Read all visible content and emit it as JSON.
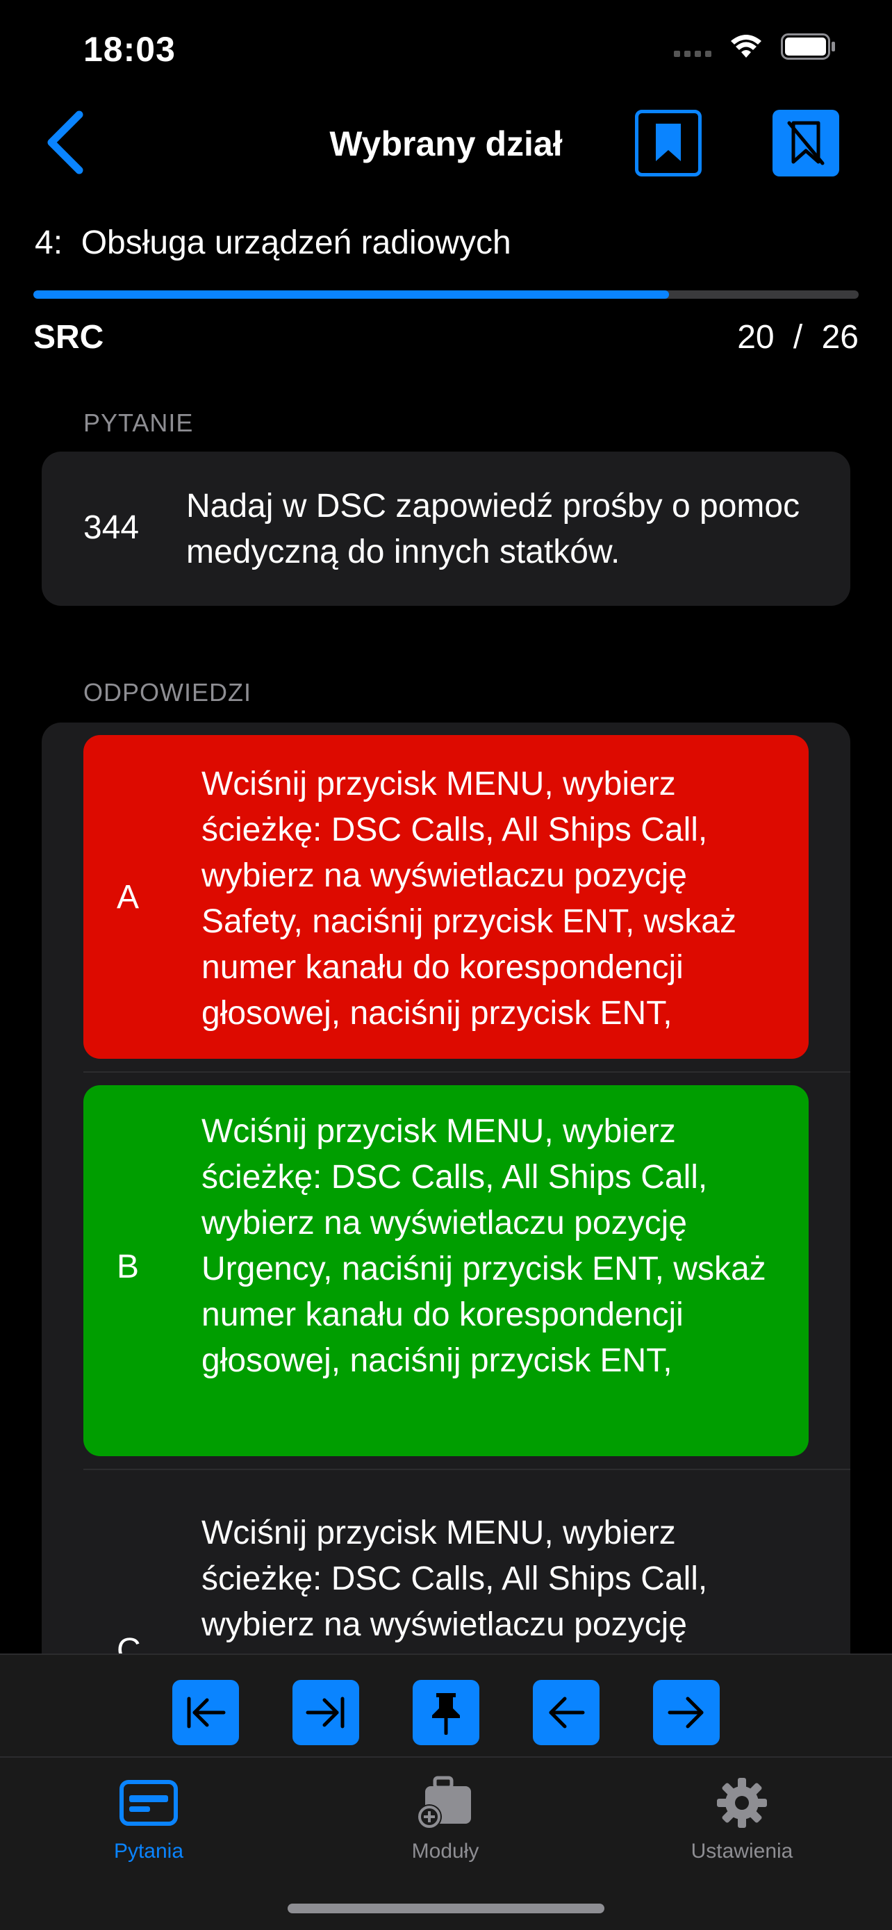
{
  "status_bar": {
    "time": "18:03"
  },
  "nav": {
    "title": "Wybrany dział"
  },
  "section": {
    "number": "4:",
    "name": "Obsługa urządzeń radiowych"
  },
  "progress": {
    "fraction": 0.77
  },
  "category": "SRC",
  "counter": {
    "current": "20",
    "separator": "/",
    "total": "26"
  },
  "question": {
    "label": "PYTANIE",
    "number": "344",
    "text": "Nadaj w DSC zapowiedź prośby o pomoc medyczną do innych statków."
  },
  "answers": {
    "label": "ODPOWIEDZI",
    "items": [
      {
        "letter": "A",
        "text": "Wciśnij przycisk MENU, wybierz ścieżkę: DSC Calls, All Ships Call, wybierz na wyświetlaczu pozycję Safety, naciśnij przycisk ENT, wskaż numer kanału do korespondencji głosowej, naciśnij przycisk ENT,",
        "state": "incorrect",
        "color": "#dd0a00"
      },
      {
        "letter": "B",
        "text": "Wciśnij przycisk MENU, wybierz ścieżkę: DSC Calls, All Ships Call, wybierz na wyświetlaczu pozycję Urgency, naciśnij przycisk ENT, wskaż numer kanału do korespondencji głosowej, naciśnij przycisk ENT,",
        "state": "correct",
        "color": "#009e00"
      },
      {
        "letter": "C",
        "text": "Wciśnij przycisk MENU, wybierz ścieżkę: DSC Calls, All Ships Call, wybierz na wyświetlaczu pozycję",
        "state": "neutral"
      }
    ]
  },
  "toolbar": {
    "buttons": [
      "first-icon",
      "last-icon",
      "pin-icon",
      "previous-icon",
      "next-icon"
    ]
  },
  "tabs": [
    {
      "label": "Pytania",
      "icon": "card-icon",
      "active": true
    },
    {
      "label": "Moduły",
      "icon": "briefcase-add-icon",
      "active": false
    },
    {
      "label": "Ustawienia",
      "icon": "gear-icon",
      "active": false
    }
  ],
  "colors": {
    "accent": "#0a84ff",
    "incorrect": "#dd0a00",
    "correct": "#009e00"
  }
}
